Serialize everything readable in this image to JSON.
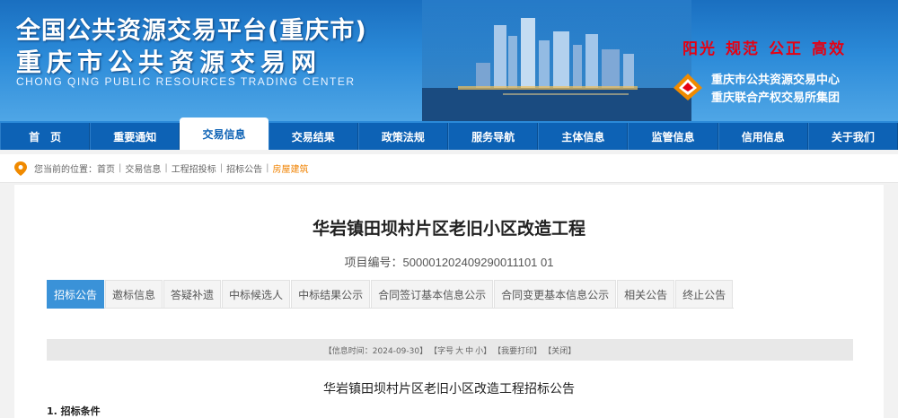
{
  "header": {
    "title": "全国公共资源交易平台(重庆市)",
    "subtitle": "重庆市公共资源交易网",
    "english": "CHONG QING PUBLIC RESOURCES TRADING CENTER",
    "slogans": [
      "阳光",
      "规范",
      "公正",
      "高效"
    ],
    "center_name": "重庆市公共资源交易中心",
    "group_name": "重庆联合产权交易所集团"
  },
  "nav": {
    "items": [
      "首　页",
      "重要通知",
      "交易信息",
      "交易结果",
      "政策法规",
      "服务导航",
      "主体信息",
      "监管信息",
      "信用信息",
      "关于我们"
    ],
    "active_index": 2
  },
  "breadcrumb": {
    "prefix": "您当前的位置：",
    "items": [
      "首页",
      "交易信息",
      "工程招投标",
      "招标公告",
      "房屋建筑"
    ]
  },
  "project": {
    "title": "华岩镇田坝村片区老旧小区改造工程",
    "number_label": "项目编号：",
    "number_value": "500001202409290011101 01"
  },
  "tabs": [
    "招标公告",
    "邀标信息",
    "答疑补遗",
    "中标候选人",
    "中标结果公示",
    "合同签订基本信息公示",
    "合同变更基本信息公示",
    "相关公告",
    "终止公告"
  ],
  "info_bar": {
    "date": "【信息时间：2024-09-30】",
    "font_size": "【字号",
    "large": "大",
    "medium": "中",
    "small": "小】",
    "print": "【我要打印】",
    "close": "【关闭】"
  },
  "notice": {
    "title": "华岩镇田坝村片区老旧小区改造工程招标公告",
    "section1": "1. 招标条件"
  },
  "colors": {
    "nav_bg": "#0d62b5",
    "tab_active": "#3a92d8",
    "breadcrumb_last": "#f08200",
    "slogan": "#e60012"
  }
}
